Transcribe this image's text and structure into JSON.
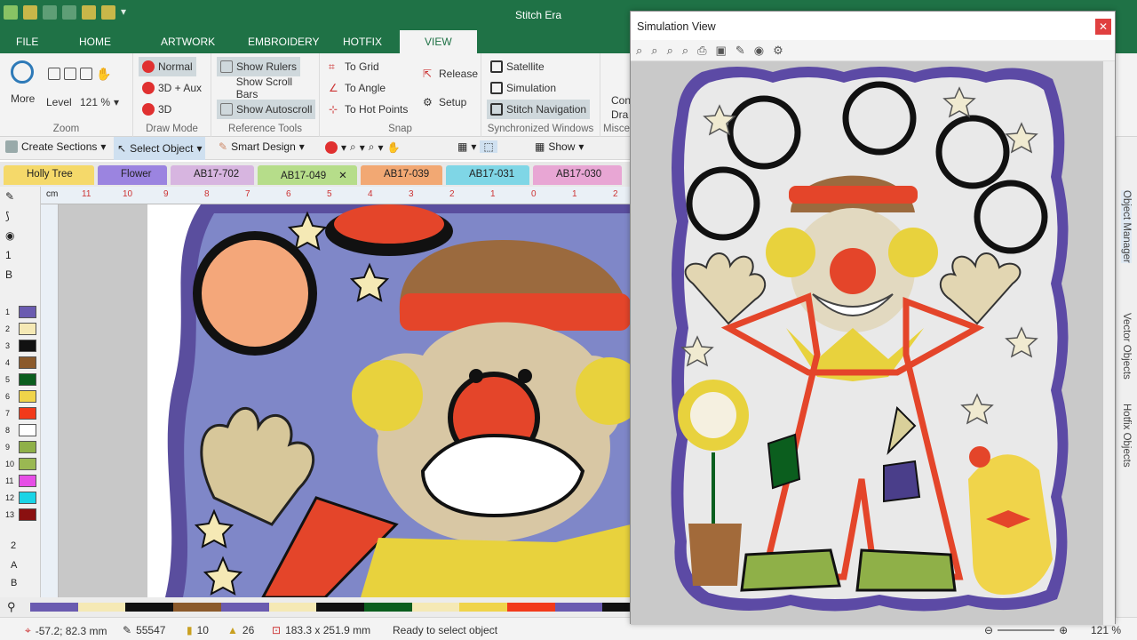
{
  "app": {
    "title": "Stitch Era"
  },
  "menu_tabs": [
    "FILE",
    "HOME",
    "ARTWORK",
    "EMBROIDERY",
    "HOTFIX",
    "VIEW"
  ],
  "ribbon": {
    "zoom": {
      "more": "More",
      "level_label": "Level",
      "level_value": "121 %",
      "group": "Zoom"
    },
    "draw_mode": {
      "normal": "Normal",
      "aux": "3D + Aux",
      "three_d": "3D",
      "group": "Draw Mode"
    },
    "reference_tools": {
      "show_rulers": "Show Rulers",
      "show_scroll_bars": "Show Scroll Bars",
      "show_autoscroll": "Show Autoscroll",
      "group": "Reference Tools"
    },
    "snap": {
      "to_grid": "To Grid",
      "to_angle": "To Angle",
      "to_hot_points": "To Hot Points",
      "release": "Release",
      "setup": "Setup",
      "group": "Snap"
    },
    "sync_windows": {
      "satellite": "Satellite",
      "simulation": "Simulation",
      "stitch_navigation": "Stitch Navigation",
      "group": "Synchronized Windows"
    },
    "misc": {
      "label1": "Con",
      "label2": "Dra",
      "group": "Misce"
    }
  },
  "toolbar2": {
    "create_sections": "Create Sections",
    "select_object": "Select Object",
    "smart_design": "Smart Design",
    "show": "Show"
  },
  "doc_tabs": [
    {
      "label": "Holly Tree",
      "color": "#f5d96a"
    },
    {
      "label": "Flower",
      "color": "#9b84e0"
    },
    {
      "label": "AB17-702",
      "color": "#d7b5e0"
    },
    {
      "label": "AB17-049",
      "color": "#b6dd8a"
    },
    {
      "label": "AB17-039",
      "color": "#f2a873"
    },
    {
      "label": "AB17-031",
      "color": "#7fd6e6"
    },
    {
      "label": "AB17-030",
      "color": "#e8a6d4"
    }
  ],
  "ruler_ticks": [
    "11",
    "10",
    "9",
    "8",
    "7",
    "6",
    "5",
    "4",
    "3",
    "2",
    "1",
    "0",
    "1",
    "2"
  ],
  "ruler_unit": "cm",
  "palette": [
    {
      "n": "1",
      "c": "#6a5bb0"
    },
    {
      "n": "2",
      "c": "#f5e9b5"
    },
    {
      "n": "3",
      "c": "#111111"
    },
    {
      "n": "4",
      "c": "#8b5a2b"
    },
    {
      "n": "5",
      "c": "#0b5e1e"
    },
    {
      "n": "6",
      "c": "#f0d44a"
    },
    {
      "n": "7",
      "c": "#f23a1a"
    },
    {
      "n": "8",
      "c": "#ffffff"
    },
    {
      "n": "9",
      "c": "#8fb048"
    },
    {
      "n": "10",
      "c": "#9ab852"
    },
    {
      "n": "11",
      "c": "#e64de6"
    },
    {
      "n": "12",
      "c": "#1ad4e6"
    },
    {
      "n": "13",
      "c": "#8a1010"
    }
  ],
  "left_bottom": {
    "count_label": "2",
    "a_label": "A",
    "b_label": "B"
  },
  "status": {
    "coords": "-57.2; 82.3 mm",
    "stitches": "55547",
    "colors": "10",
    "objects": "26",
    "size": "183.3 x 251.9 mm",
    "message": "Ready to select object",
    "zoom": "121 %"
  },
  "simulation": {
    "title": "Simulation View"
  },
  "right_panel": [
    "Object Manager",
    "Vector Objects",
    "Hotfix Objects"
  ]
}
